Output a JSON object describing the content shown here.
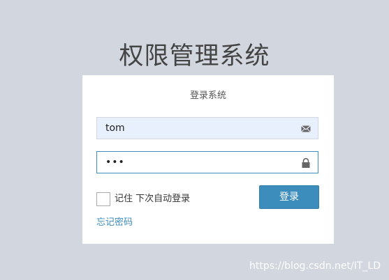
{
  "app": {
    "title": "权限管理系统"
  },
  "login": {
    "box_title": "登录系统",
    "username_value": "tom",
    "password_value": "•••",
    "remember_label": "记住 下次自动登录",
    "submit_label": "登录",
    "forgot_label": "忘记密码",
    "remember_checked": false
  },
  "icons": {
    "username_icon": "envelope-icon",
    "password_icon": "lock-icon"
  },
  "colors": {
    "background": "#d2d6de",
    "accent": "#3c8dbc",
    "autofill": "#e8f0fe"
  },
  "watermark": {
    "text": "https://blog.csdn.net/IT_LD"
  }
}
